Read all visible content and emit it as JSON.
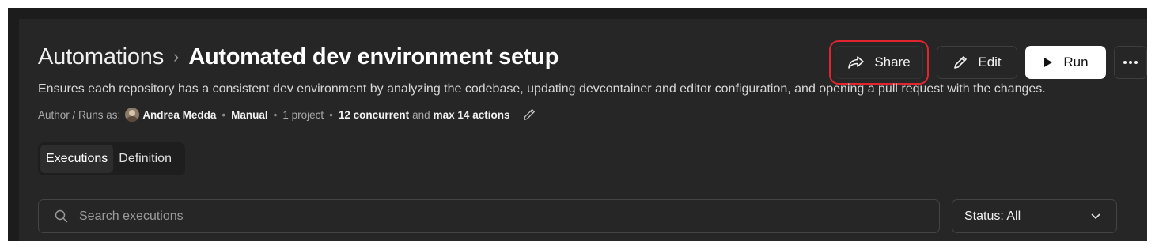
{
  "header": {
    "breadcrumb_root": "Automations",
    "breadcrumb_sep": "›",
    "title": "Automated dev environment setup"
  },
  "actions": {
    "share_label": "Share",
    "edit_label": "Edit",
    "run_label": "Run",
    "more_icon": "more-horizontal-icon",
    "highlight_color": "#e0252f"
  },
  "description": "Ensures each repository has a consistent dev environment by analyzing the codebase, updating devcontainer and editor configuration, and opening a pull request with the changes.",
  "meta": {
    "author_label": "Author / Runs as:",
    "author_name": "Andrea Medda",
    "trigger": "Manual",
    "projects": "1 project",
    "concurrency": "12 concurrent",
    "and_text": "and",
    "max_actions": "max 14 actions"
  },
  "tabs": [
    {
      "label": "Executions",
      "active": true
    },
    {
      "label": "Definition",
      "active": false
    }
  ],
  "search": {
    "placeholder": "Search executions"
  },
  "status_filter": {
    "label": "Status: All"
  },
  "colors": {
    "background": "#262626",
    "run_button": "#ffffff"
  }
}
